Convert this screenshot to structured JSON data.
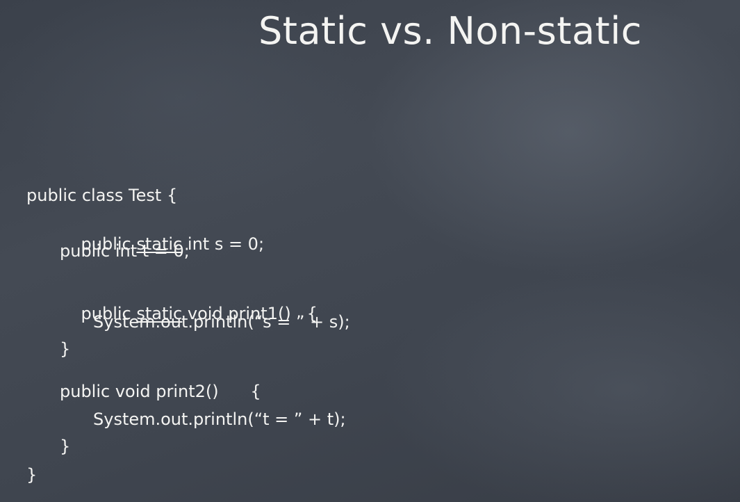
{
  "slide": {
    "title": "Static vs. Non-static",
    "code": {
      "class_open": "public class Test {",
      "field_s": {
        "pre": "public ",
        "keyword": "static",
        "post": " int s = 0;"
      },
      "field_t": "public int t = 0;",
      "print1_sig": {
        "pre": "public ",
        "keyword": "static",
        "post": " void print1()   {"
      },
      "print1_body": "System.out.println(“s = ” + s);",
      "print1_close": "}",
      "print2_sig": "public void print2()      {",
      "print2_body": "System.out.println(“t = ” + t);",
      "print2_close": "}",
      "class_close": "}"
    }
  }
}
